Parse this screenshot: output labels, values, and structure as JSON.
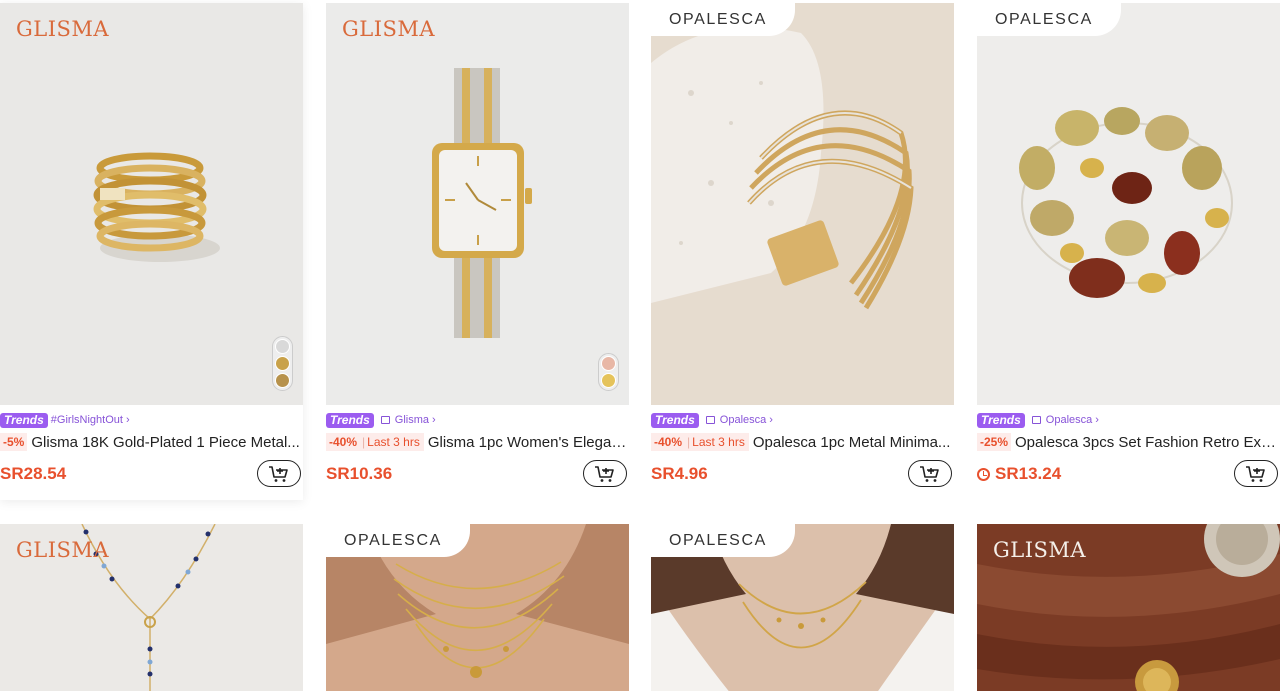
{
  "products": [
    {
      "brand": "GLISMA",
      "trends_label": "Trends",
      "tag": "#GirlsNightOut",
      "tag_chevron": "›",
      "discount": "-5%",
      "title": "Glisma 18K Gold-Plated 1 Piece Metal...",
      "price": "SR28.54",
      "swatches": [
        "#d9d9d9",
        "#c9a24a",
        "#b7924c"
      ]
    },
    {
      "brand": "GLISMA",
      "trends_label": "Trends",
      "tag": "Glisma",
      "tag_chevron": "›",
      "discount": "-40%",
      "last": "Last 3 hrs",
      "title": "Glisma 1pc Women's Elegan...",
      "price": "SR10.36",
      "swatches": [
        "#e8b7a6",
        "#e5c35b"
      ]
    },
    {
      "brand": "OPALESCA",
      "trends_label": "Trends",
      "tag": "Opalesca",
      "tag_chevron": "›",
      "discount": "-40%",
      "last": "Last 3 hrs",
      "title": "Opalesca 1pc Metal Minima...",
      "price": "SR4.96"
    },
    {
      "brand": "OPALESCA",
      "trends_label": "Trends",
      "tag": "Opalesca",
      "tag_chevron": "›",
      "discount": "-25%",
      "title": "Opalesca 3pcs Set Fashion Retro Exa...",
      "price": "SR13.24"
    },
    {
      "brand": "GLISMA"
    },
    {
      "brand": "OPALESCA"
    },
    {
      "brand": "OPALESCA"
    },
    {
      "brand": "GLISMA"
    }
  ],
  "colors": {
    "price": "#e8502d",
    "trends_badge": "#9b5cf0",
    "brand_glisma": "#d96a3b"
  },
  "icons": {
    "cart": "add-to-cart-icon",
    "store": "store-icon",
    "clock": "clock-icon"
  }
}
